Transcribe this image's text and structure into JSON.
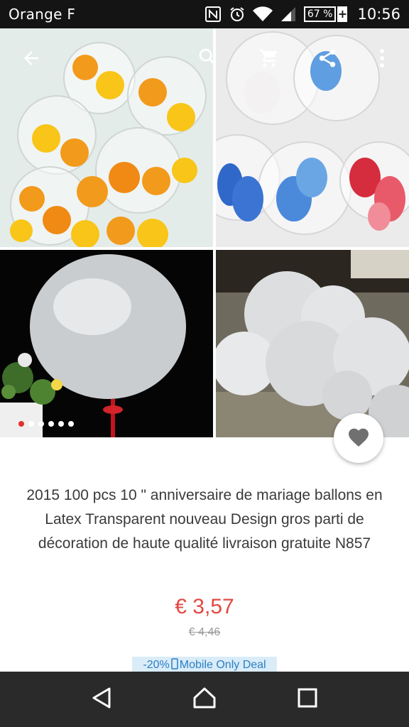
{
  "status_bar": {
    "carrier": "Orange F",
    "battery": "67 %",
    "battery_plus": "+",
    "time": "10:56",
    "icons": [
      "nfc-icon",
      "alarm-icon",
      "wifi-icon",
      "signal-icon",
      "battery-icon"
    ]
  },
  "toolbar": {
    "icons": [
      "back-arrow-icon",
      "search-icon",
      "cart-icon",
      "share-icon",
      "more-vert-icon"
    ]
  },
  "gallery": {
    "images": [
      "orange-yellow-balloons-image",
      "blue-red-heart-balloons-image",
      "clear-balloon-image",
      "clear-balloons-room-image"
    ],
    "dots_total": 6,
    "dots_active_index": 0
  },
  "product": {
    "title": "2015 100 pcs 10 \" anniversaire de mariage ballons en Latex Transparent nouveau Design gros parti de décoration de haute qualité livraison gratuite N857",
    "price": "€ 3,57",
    "old_price": "€ 4,46",
    "deal_discount": "-20%",
    "deal_label": "Mobile Only Deal"
  },
  "nav_bar": {
    "icons": [
      "back-triangle-icon",
      "home-icon",
      "recents-icon"
    ]
  },
  "colors": {
    "accent_red": "#e04a41",
    "deal_blue": "#2b7fc4",
    "deal_bg": "#d9ecf8"
  }
}
